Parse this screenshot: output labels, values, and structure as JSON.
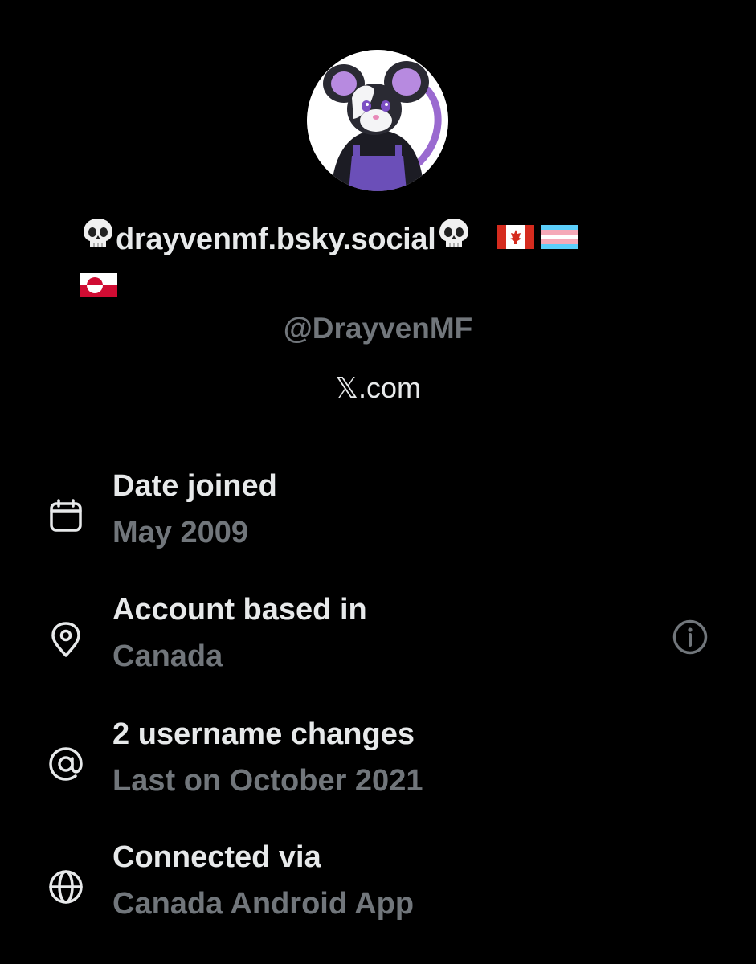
{
  "profile": {
    "display_name": "drayvenmf.bsky.social",
    "handle": "@DrayvenMF",
    "site": "𝕏.com"
  },
  "info": [
    {
      "icon": "calendar-icon",
      "label": "Date joined",
      "value": "May 2009"
    },
    {
      "icon": "location-pin-icon",
      "label": "Account based in",
      "value": "Canada"
    },
    {
      "icon": "at-sign-icon",
      "label": "2 username changes",
      "value": "Last on October 2021"
    },
    {
      "icon": "globe-icon",
      "label": "Connected via",
      "value": "Canada Android App"
    }
  ],
  "colors": {
    "background": "#000000",
    "primary_text": "#e7e9ea",
    "secondary_text": "#71767b"
  }
}
